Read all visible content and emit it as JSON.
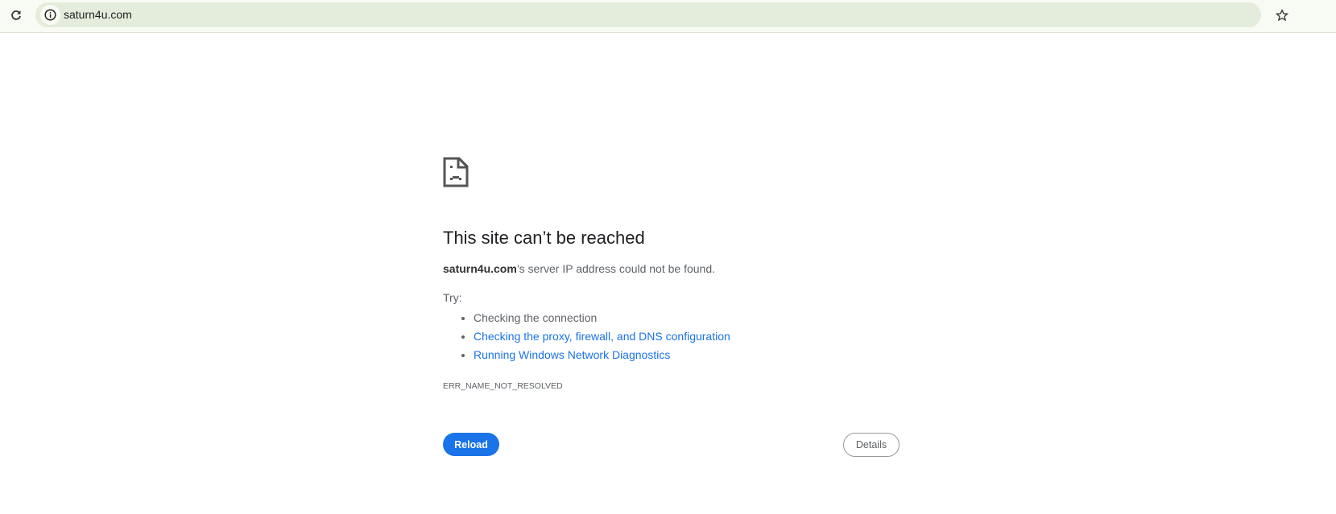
{
  "browser": {
    "url": "saturn4u.com"
  },
  "error": {
    "title": "This site can’t be reached",
    "host": "saturn4u.com",
    "message": "’s server IP address could not be found.",
    "try_label": "Try:",
    "suggestions": [
      {
        "text": "Checking the connection",
        "link": false
      },
      {
        "text": "Checking the proxy, firewall, and DNS configuration",
        "link": true
      },
      {
        "text": "Running Windows Network Diagnostics",
        "link": true
      }
    ],
    "code": "ERR_NAME_NOT_RESOLVED",
    "reload_label": "Reload",
    "details_label": "Details"
  }
}
